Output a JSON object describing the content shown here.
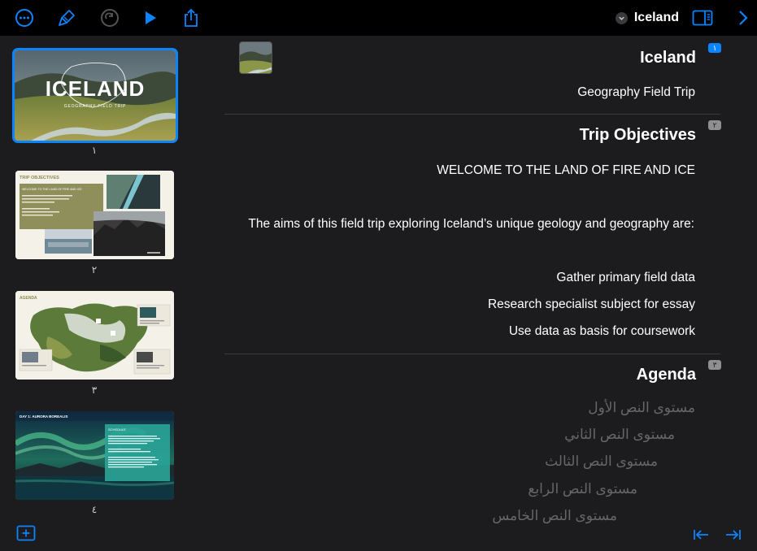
{
  "toolbar": {
    "document_title": "Iceland",
    "icons": [
      "more-icon",
      "format-brush-icon",
      "redo-icon",
      "play-icon",
      "share-icon",
      "chevron-down-icon",
      "sidebar-toggle-icon",
      "chevron-right-icon"
    ],
    "accent": "#0a84ff"
  },
  "sidebar": {
    "slides": [
      {
        "number": "١",
        "title_art": "ICELAND",
        "subtitle_art": "GEOGRAPHY FIELD TRIP",
        "selected": true
      },
      {
        "number": "٢",
        "heading": "TRIP OBJECTIVES",
        "box_title": "WELCOME TO THE LAND OF FIRE AND ICE"
      },
      {
        "number": "٣",
        "heading": "AGENDA"
      },
      {
        "number": "٤",
        "heading": "DAY 1: AURORA BOREALIS",
        "box_title": "SCHEDULE"
      }
    ],
    "add_slide_icon": "add-slide-icon"
  },
  "outline": {
    "slides": [
      {
        "badge": "١",
        "title": "Iceland",
        "lines": [
          "Geography Field Trip"
        ]
      },
      {
        "badge": "٢",
        "title": "Trip Objectives",
        "lines": [
          "WELCOME TO THE LAND OF FIRE AND ICE",
          "The aims of this field trip exploring Iceland’s unique geology and geography are:",
          "Gather primary field data",
          "Research specialist subject for essay",
          "Use data as basis for coursework"
        ]
      },
      {
        "badge": "٣",
        "title": "Agenda",
        "lines": [
          "مستوى النص الأول",
          "مستوى النص الثاني",
          "مستوى النص الثالث",
          "مستوى النص الرابع",
          "مستوى النص الخامس"
        ]
      }
    ],
    "nav_icons": [
      "outdent-icon",
      "indent-icon"
    ]
  }
}
